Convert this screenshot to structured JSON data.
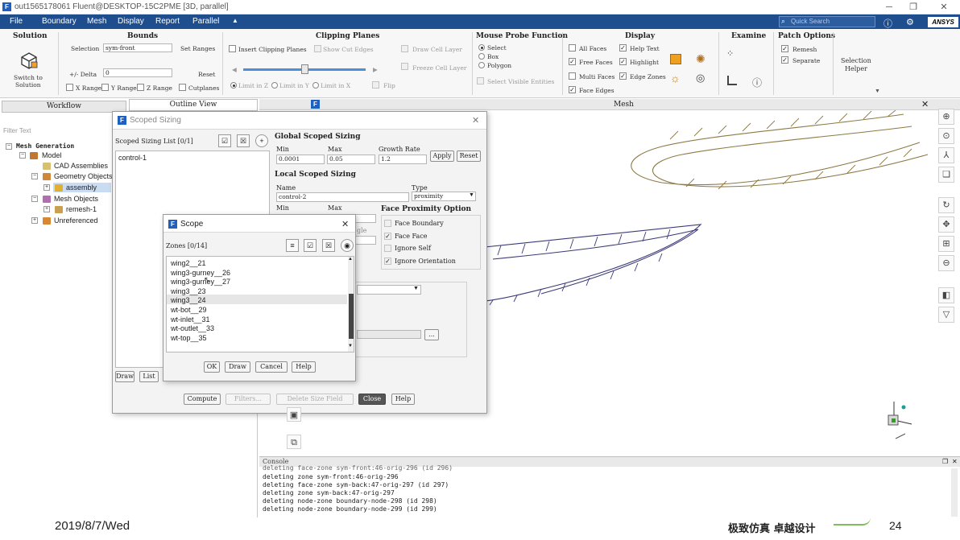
{
  "window": {
    "title": "out1565178061 Fluent@DESKTOP-15C2PME  [3D, parallel]",
    "logo_letter": "F"
  },
  "menu": {
    "items": [
      "File",
      "Boundary",
      "Mesh",
      "Display",
      "Report",
      "Parallel"
    ],
    "collapse_glyph": "▲",
    "search_placeholder": "Quick Search",
    "brand": "ANSYS"
  },
  "ribbon": {
    "solution": {
      "title": "Solution",
      "switch_label_1": "Switch to",
      "switch_label_2": "Solution"
    },
    "bounds": {
      "title": "Bounds",
      "selection_label": "Selection",
      "selection_value": "sym-front",
      "set_ranges": "Set Ranges",
      "delta_label": "+/- Delta",
      "delta_value": "0",
      "reset": "Reset",
      "x_range": "X Range",
      "y_range": "Y Range",
      "z_range": "Z Range",
      "cutplanes": "Cutplanes"
    },
    "clipping": {
      "title": "Clipping Planes",
      "insert": "Insert Clipping Planes",
      "show_cut": "Show Cut Edges",
      "draw_cell": "Draw Cell Layer",
      "freeze_cell": "Freeze Cell Layer",
      "limit_z": "Limit in Z",
      "limit_y": "Limit in Y",
      "limit_x": "Limit in X",
      "flip": "Flip",
      "slider_fraction": 0.5
    },
    "mouse_probe": {
      "title": "Mouse Probe Function",
      "select": "Select",
      "box": "Box",
      "polygon": "Polygon",
      "select_visible": "Select Visible Entities"
    },
    "display": {
      "title": "Display",
      "all_faces": "All Faces",
      "help_text": "Help Text",
      "free_faces": "Free Faces",
      "highlight": "Highlight",
      "multi_faces": "Multi Faces",
      "edge_zones": "Edge Zones",
      "face_edges": "Face Edges"
    },
    "examine": {
      "title": "Examine"
    },
    "patch": {
      "title": "Patch Options",
      "remesh": "Remesh",
      "separate": "Separate"
    },
    "selection_helper": {
      "line1": "Selection",
      "line2": "Helper"
    }
  },
  "left": {
    "tab_workflow": "Workflow",
    "tab_outline": "Outline View",
    "filter_placeholder": "Filter Text",
    "tree": {
      "root": "Mesh Generation",
      "model": "Model",
      "cad": "CAD Assemblies",
      "geometry": "Geometry Objects",
      "assembly": "assembly",
      "mesh_objects": "Mesh Objects",
      "remesh": "remesh-1",
      "unreferenced": "Unreferenced"
    }
  },
  "viewport": {
    "title": "Mesh"
  },
  "scoped": {
    "title": "Scoped Sizing",
    "list_label": "Scoped Sizing List [0/1]",
    "list_items": [
      "control-1"
    ],
    "global_title": "Global Scoped Sizing",
    "min_label": "Min",
    "max_label": "Max",
    "growth_label": "Growth Rate",
    "min_value": "0.0001",
    "max_value": "0.05",
    "growth_value": "1.2",
    "apply": "Apply",
    "reset": "Reset",
    "local_title": "Local Scoped Sizing",
    "name_label": "Name",
    "type_label": "Type",
    "name_value": "control-2",
    "type_value": "proximity",
    "local_min": "Min",
    "local_max": "Max",
    "gle_fragment": "gle",
    "proximity_title": "Face Proximity Option",
    "face_boundary": "Face Boundary",
    "face_face": "Face Face",
    "ignore_self": "Ignore Self",
    "ignore_orientation": "Ignore Orientation",
    "ellipsis": "...",
    "draw": "Draw",
    "list": "List",
    "compute": "Compute",
    "filters": "Filters...",
    "delete_size_field": "Delete Size Field",
    "close": "Close",
    "help": "Help"
  },
  "scope": {
    "title": "Scope",
    "zones_label": "Zones [0/14]",
    "zones": [
      "wing2__21",
      "wing3-gurney__26",
      "wing3-gurney__27",
      "wing3__23",
      "wing3__24",
      "wt-bot__29",
      "wt-inlet__31",
      "wt-outlet__33",
      "wt-top__35"
    ],
    "ok": "OK",
    "draw": "Draw",
    "cancel": "Cancel",
    "help": "Help"
  },
  "console": {
    "title": "Console",
    "lines": [
      "deleting face-zone sym-front:46-orig-296 (id 296)",
      "deleting zone sym-front:46-orig-296",
      "deleting face-zone sym-back:47-orig-297 (id 297)",
      "deleting zone sym-back:47-orig-297",
      "deleting node-zone boundary-node-298 (id 298)",
      "deleting node-zone boundary-node-299 (id 299)"
    ]
  },
  "footer": {
    "date": "2019/8/7/Wed",
    "slogan": "极致仿真 卓越设计",
    "page": "24"
  },
  "colors": {
    "menu_bg": "#1f4e8f",
    "fluent_blue": "#1f5fbf",
    "mesh_olive": "#8c7a45",
    "mesh_navy": "#3a3a78"
  }
}
